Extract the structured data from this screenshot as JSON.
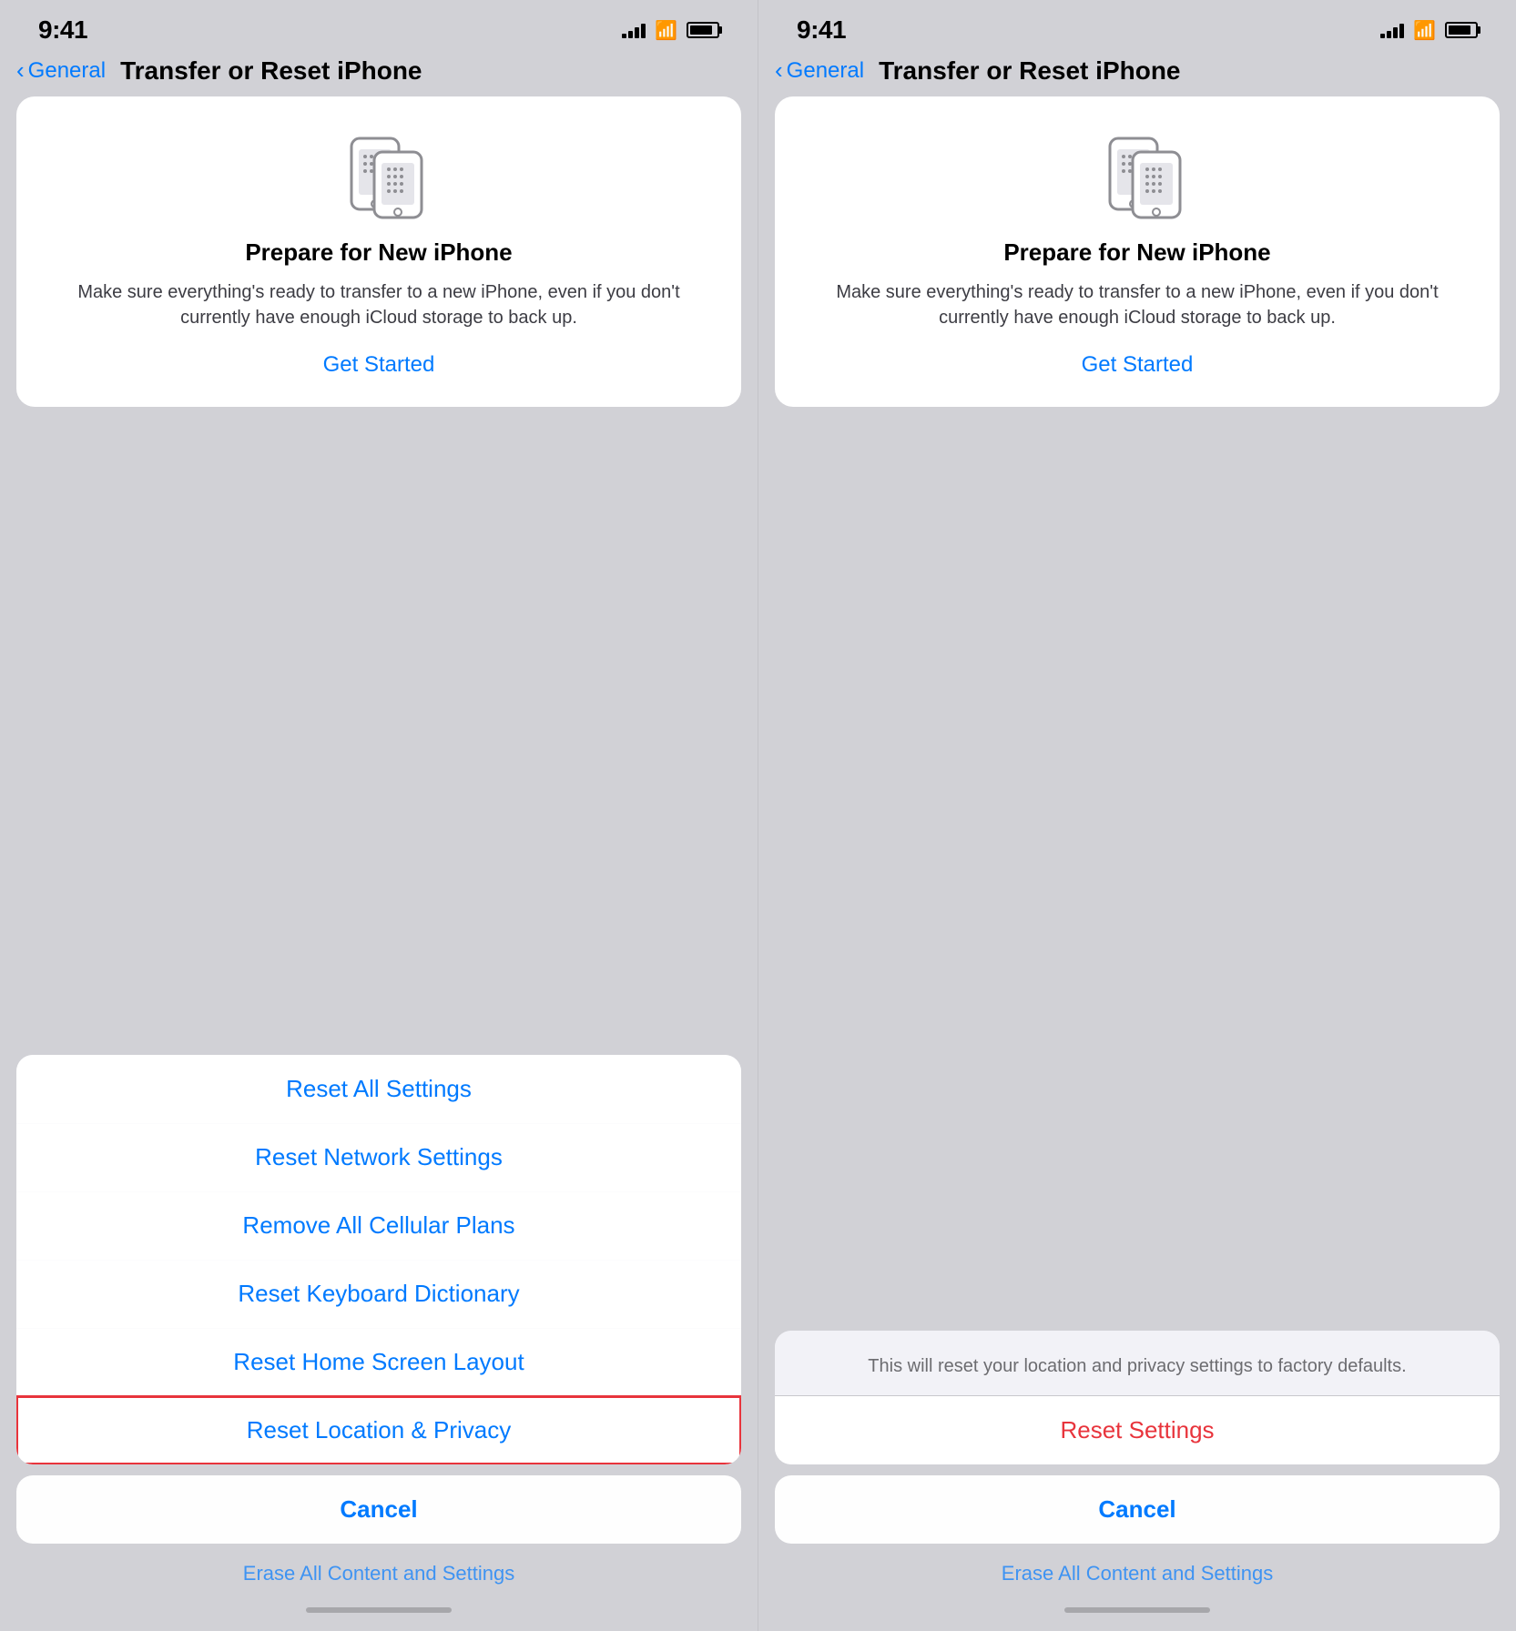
{
  "left_panel": {
    "status": {
      "time": "9:41"
    },
    "nav": {
      "back_label": "General",
      "title": "Transfer or Reset iPhone"
    },
    "prepare_card": {
      "title": "Prepare for New iPhone",
      "description": "Make sure everything's ready to transfer to a new iPhone, even if you don't currently have enough iCloud storage to back up.",
      "get_started": "Get Started"
    },
    "action_sheet": {
      "items": [
        "Reset All Settings",
        "Reset Network Settings",
        "Remove All Cellular Plans",
        "Reset Keyboard Dictionary",
        "Reset Home Screen Layout",
        "Reset Location & Privacy"
      ],
      "highlighted_index": 5
    },
    "cancel": "Cancel",
    "erase_partial": "Erase All Content and Settings"
  },
  "right_panel": {
    "status": {
      "time": "9:41"
    },
    "nav": {
      "back_label": "General",
      "title": "Transfer or Reset iPhone"
    },
    "prepare_card": {
      "title": "Prepare for New iPhone",
      "description": "Make sure everything's ready to transfer to a new iPhone, even if you don't currently have enough iCloud storage to back up.",
      "get_started": "Get Started"
    },
    "confirm_sheet": {
      "description": "This will reset your location and privacy settings to factory defaults.",
      "reset_label": "Reset Settings",
      "cancel_label": "Cancel"
    },
    "erase_partial": "Erase All Content and Settings"
  }
}
